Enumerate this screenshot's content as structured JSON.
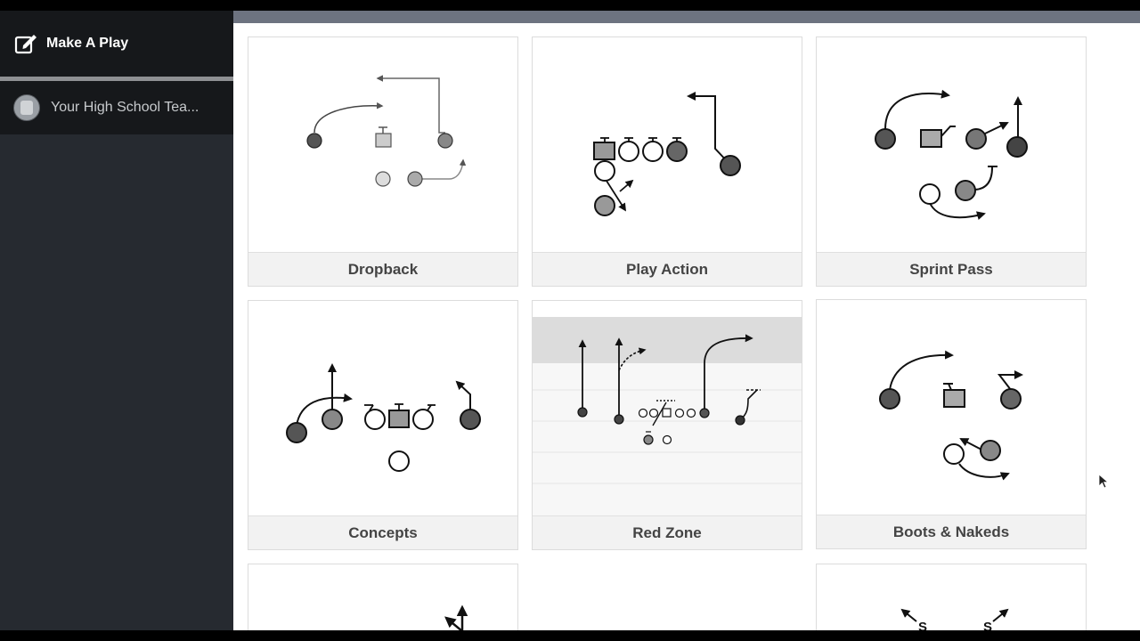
{
  "sidebar": {
    "make_play": {
      "label": "Make A Play",
      "icon": "edit-square-icon"
    },
    "team": {
      "label": "Your High School Tea...",
      "icon": "team-logo-avatar"
    }
  },
  "cards": [
    {
      "title": "Dropback"
    },
    {
      "title": "Play Action"
    },
    {
      "title": "Sprint Pass"
    },
    {
      "title": "Concepts"
    },
    {
      "title": "Red Zone"
    },
    {
      "title": "Boots & Nakeds"
    }
  ],
  "colors": {
    "sidebar_bg": "#262a30",
    "sidebar_item_bg": "#16181b",
    "header_stripe": "#6d7380",
    "player_dark": "#555555",
    "player_mid": "#999999"
  }
}
